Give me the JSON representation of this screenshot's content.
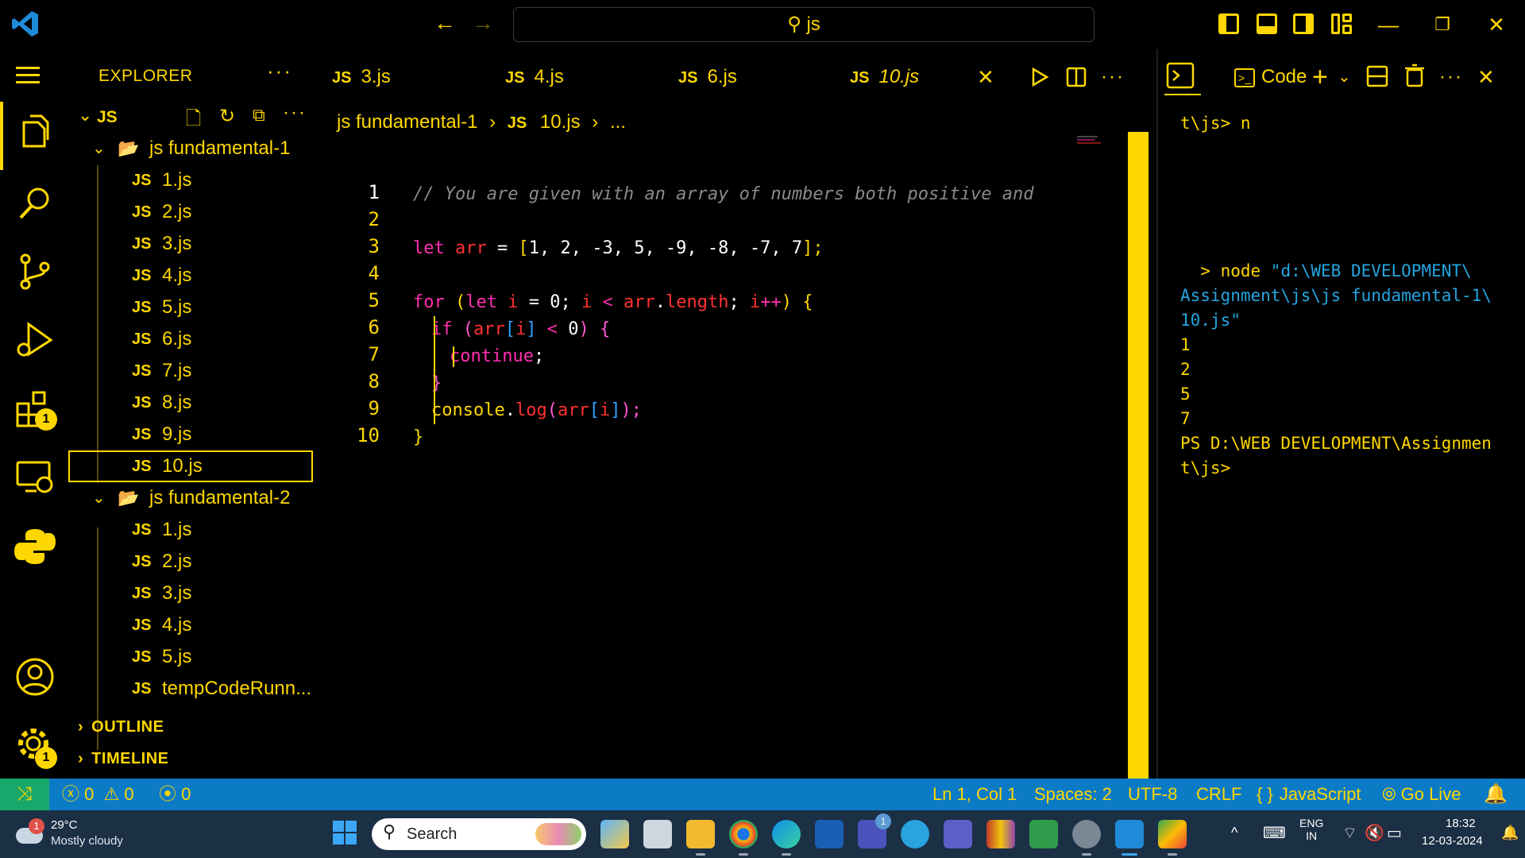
{
  "titlebar": {
    "search_text": "js",
    "back_icon": "arrow-left-icon",
    "forward_icon": "arrow-right-icon"
  },
  "colors": {
    "accent": "#ffd700",
    "statusbar": "#0c7bc6",
    "remote": "#19a86b",
    "taskbar": "#1b2f45",
    "keyword": "#ff2fb0",
    "variable": "#ff3030",
    "comment": "#8a8a8a"
  },
  "activitybar": {
    "extensions_badge": "1",
    "settings_badge": "1"
  },
  "sidebar": {
    "title": "EXPLORER",
    "more": "···",
    "root_label": "JS",
    "folders": [
      {
        "label": "js fundamental-1",
        "files": [
          "1.js",
          "2.js",
          "3.js",
          "4.js",
          "5.js",
          "6.js",
          "7.js",
          "8.js",
          "9.js",
          "10.js"
        ]
      },
      {
        "label": "js fundamental-2",
        "files": [
          "1.js",
          "2.js",
          "3.js",
          "4.js",
          "5.js",
          "tempCodeRunn..."
        ]
      }
    ],
    "file_icon_label": "JS",
    "outline": "OUTLINE",
    "timeline": "TIMELINE"
  },
  "editor": {
    "tabs": [
      {
        "label": "3.js"
      },
      {
        "label": "4.js"
      },
      {
        "label": "6.js"
      },
      {
        "label": "10.js",
        "active": true
      }
    ],
    "tab_close": "✕",
    "more": "···",
    "breadcrumb": {
      "folder": "js fundamental-1",
      "file_icon": "JS",
      "file": "10.js",
      "tail": "..."
    },
    "line_numbers": [
      "1",
      "2",
      "3",
      "4",
      "5",
      "6",
      "7",
      "8",
      "9",
      "10"
    ],
    "code": {
      "l1": "// You are given with an array of numbers both positive and",
      "l3_kw": "let",
      "l3_var": "arr",
      "l3_eq": " = ",
      "l3_open": "[",
      "l3_values": "1, 2, -3, 5, -9, -8, -7, 7",
      "l3_close": "];",
      "l5_for": "for",
      "l5_open": " (",
      "l5_let": "let",
      "l5_i": "i",
      "l5_init": " = ",
      "l5_zero": "0",
      "l5_semi": "; ",
      "l5_i2": "i",
      "l5_lt": " < ",
      "l5_arr": "arr",
      "l5_dot": ".",
      "l5_length": "length",
      "l5_semi2": "; ",
      "l5_i3": "i",
      "l5_inc": "++",
      "l5_close": ") {",
      "l6_if": "if",
      "l6_open": " (",
      "l6_arr": "arr",
      "l6_lb": "[",
      "l6_i": "i",
      "l6_rb": "]",
      "l6_lt": " < ",
      "l6_zero": "0",
      "l6_close": ") {",
      "l7_continue": "continue",
      "l7_semi": ";",
      "l8_brace": "}",
      "l9_console": "console",
      "l9_dot": ".",
      "l9_log": "log",
      "l9_open": "(",
      "l9_arr": "arr",
      "l9_lb": "[",
      "l9_i": "i",
      "l9_rb": "]",
      "l9_close": ");",
      "l10_brace": "}"
    }
  },
  "panel": {
    "code_label": "Code",
    "terminal_lines": {
      "t1": "t\\js> n",
      "t2_arrow": "  > node ",
      "t2_path": "\"d:\\WEB DEVELOPMENT\\",
      "t3": "Assignment\\js\\js fundamental-1\\",
      "t4": "10.js\"",
      "o1": "1",
      "o2": "2",
      "o3": "5",
      "o4": "7",
      "p1": "PS D:\\WEB DEVELOPMENT\\Assignmen",
      "p2": "t\\js>"
    }
  },
  "statusbar": {
    "errors": "0",
    "warnings": "0",
    "ports": "0",
    "position": "Ln 1, Col 1",
    "spaces": "Spaces: 2",
    "encoding": "UTF-8",
    "eol": "CRLF",
    "language": "JavaScript",
    "golive": "Go Live"
  },
  "taskbar": {
    "weather_badge": "1",
    "temperature": "29°C",
    "weather": "Mostly cloudy",
    "search_label": "Search",
    "teams_badge": "1",
    "language_top": "ENG",
    "language_bottom": "IN",
    "time": "18:32",
    "date": "12-03-2024"
  }
}
